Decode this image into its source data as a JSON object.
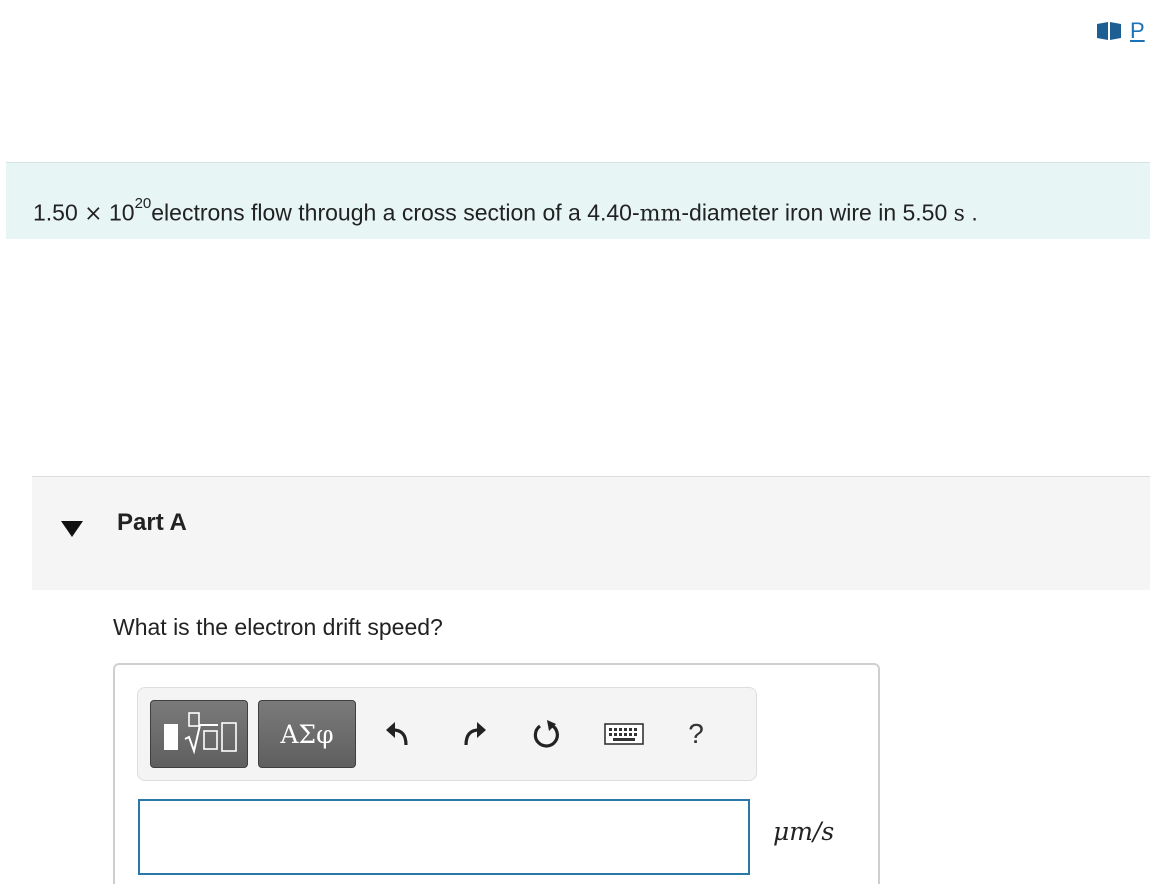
{
  "resource": {
    "link_text": "P"
  },
  "problem": {
    "coefficient": "1.50",
    "times_sign": "×",
    "base": "10",
    "exponent": "20",
    "text_before_unit": "electrons flow through a cross section of a 4.40-",
    "unit_mm": "mm",
    "text_after_unit": "-diameter iron wire in 5.50",
    "unit_s": "s",
    "end": " ."
  },
  "part": {
    "title": "Part A"
  },
  "question": {
    "text": "What is the electron drift speed?"
  },
  "toolbar": {
    "symbols_label": "ΑΣφ",
    "help_label": "?",
    "icons": [
      "templates-icon",
      "undo-icon",
      "redo-icon",
      "reset-icon",
      "keyboard-icon",
      "help-icon"
    ]
  },
  "answer": {
    "value": "",
    "units": "μm/s"
  },
  "colors": {
    "problem_bg": "#e7f5f5",
    "link": "#1a73b8",
    "input_border": "#2a78a8",
    "part_bg": "#f5f5f5"
  }
}
